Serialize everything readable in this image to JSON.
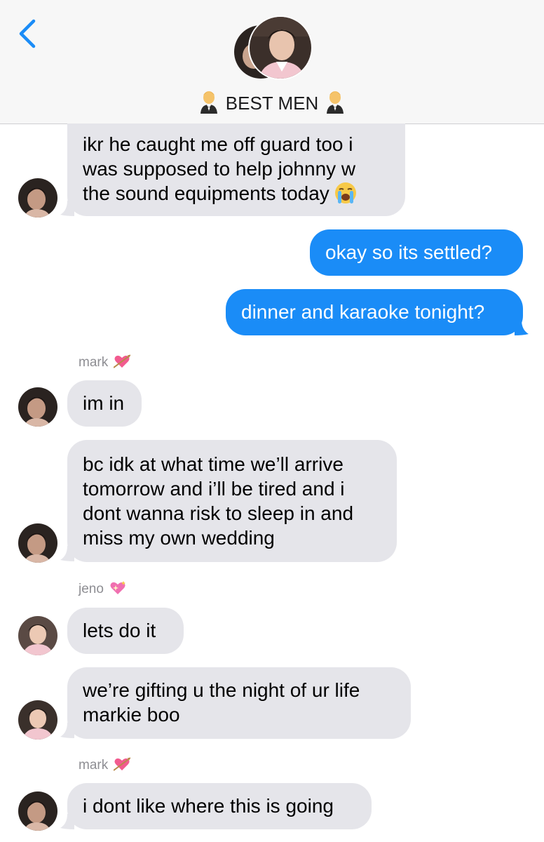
{
  "header": {
    "title": "BEST MEN",
    "back_icon": "chevron-left-icon",
    "title_emoji": "man-in-tuxedo-emoji"
  },
  "colors": {
    "accent": "#1a8cf7",
    "incoming_bubble": "#e5e5ea",
    "sender_name": "#8e8e93"
  },
  "messages": [
    {
      "direction": "in",
      "lines": [
        "ikr he caught me off guard too i",
        "was supposed to help johnny w",
        "the sound equipments today"
      ],
      "emoji": "loudly-crying-face-emoji"
    },
    {
      "direction": "out",
      "lines": [
        "okay so its settled?"
      ]
    },
    {
      "direction": "out",
      "lines": [
        "dinner and karaoke tonight?"
      ]
    },
    {
      "direction": "in",
      "sender": "mark",
      "sender_emoji": "heart-with-arrow-emoji",
      "lines": [
        "im in"
      ]
    },
    {
      "direction": "in",
      "lines": [
        "bc idk at what time we’ll arrive",
        "tomorrow and i’ll be tired and i",
        "dont wanna risk to sleep in and",
        "miss my own wedding"
      ]
    },
    {
      "direction": "in",
      "sender": "jeno",
      "sender_emoji": "sparkling-heart-emoji",
      "lines": [
        "lets do it"
      ]
    },
    {
      "direction": "in",
      "lines": [
        "we’re gifting u the night of ur life",
        "markie boo"
      ]
    },
    {
      "direction": "in",
      "sender": "mark",
      "sender_emoji": "heart-with-arrow-emoji",
      "lines": [
        "i dont like where this is going"
      ]
    }
  ]
}
